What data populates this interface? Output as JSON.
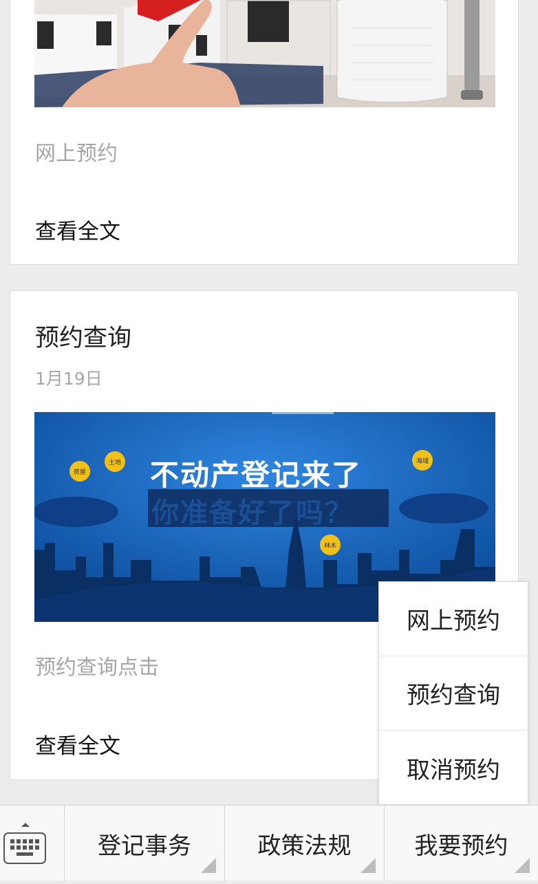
{
  "articles": [
    {
      "description": "网上预约",
      "read_more": "查看全文"
    },
    {
      "title": "预约查询",
      "date": "1月19日",
      "banner": {
        "headline": "不动产登记来了",
        "subheadline": "你准备好了吗？",
        "tags": [
          "房屋",
          "土地",
          "海域",
          "林木"
        ]
      },
      "description": "预约查询点击",
      "read_more": "查看全文"
    }
  ],
  "menu": {
    "keyboard_icon": "keyboard-icon",
    "items": [
      "登记事务",
      "政策法规",
      "我要预约"
    ]
  },
  "submenu": {
    "items": [
      "网上预约",
      "预约查询",
      "取消预约"
    ]
  },
  "colors": {
    "banner_blue": "#1565c0",
    "tag_yellow": "#f2c01a",
    "page_bg": "#ececec"
  }
}
